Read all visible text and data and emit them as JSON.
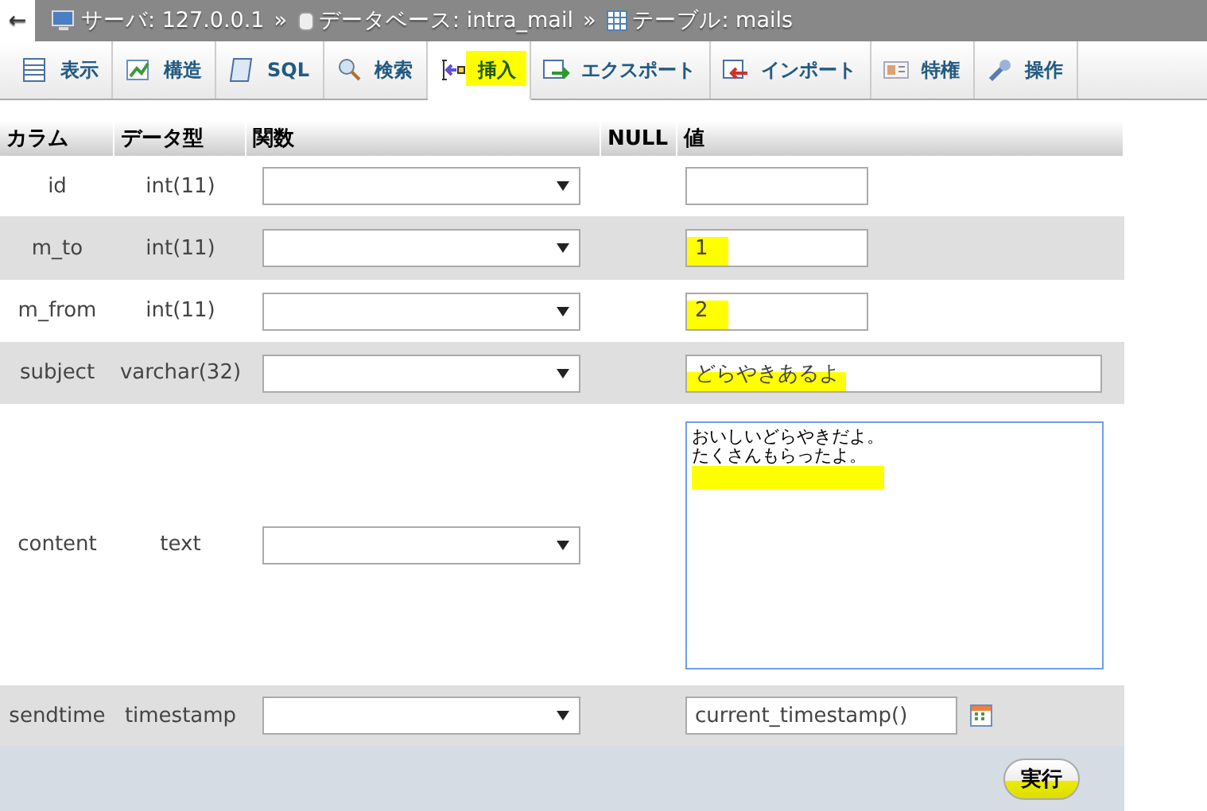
{
  "back": "←",
  "breadcrumb": [
    {
      "kind": "server",
      "label": "サーバ: 127.0.0.1",
      "separator": "»"
    },
    {
      "kind": "database",
      "label": "データベース: intra_mail",
      "separator": "»"
    },
    {
      "kind": "table",
      "label": "テーブル: mails"
    }
  ],
  "tabs": [
    {
      "kind": "browse",
      "label": "表示",
      "selected": false,
      "highlighted": false
    },
    {
      "kind": "structure",
      "label": "構造",
      "selected": false,
      "highlighted": false
    },
    {
      "kind": "sql",
      "label": "SQL",
      "selected": false,
      "highlighted": false
    },
    {
      "kind": "search",
      "label": "検索",
      "selected": false,
      "highlighted": false
    },
    {
      "kind": "insert",
      "label": "挿入",
      "selected": true,
      "highlighted": true
    },
    {
      "kind": "export",
      "label": "エクスポート",
      "selected": false,
      "highlighted": false
    },
    {
      "kind": "import",
      "label": "インポート",
      "selected": false,
      "highlighted": false
    },
    {
      "kind": "privileges",
      "label": "特権",
      "selected": false,
      "highlighted": false
    },
    {
      "kind": "operations",
      "label": "操作",
      "selected": false,
      "highlighted": false
    }
  ],
  "table": {
    "columns": [
      "カラム",
      "データ型",
      "関数",
      "NULL",
      "値"
    ],
    "rows": [
      {
        "name": "id",
        "type": "int(11)",
        "kind": "short",
        "highlighted": false
      },
      {
        "name": "m_to",
        "type": "int(11)",
        "kind": "short",
        "value": "1",
        "highlighted": true
      },
      {
        "name": "m_from",
        "type": "int(11)",
        "kind": "short",
        "value": "2",
        "highlighted": true
      },
      {
        "name": "subject",
        "type": "varchar(32)",
        "kind": "long",
        "value": "どらやきあるよ",
        "highlighted": true
      },
      {
        "name": "content",
        "type": "text",
        "kind": "textarea",
        "lines": [
          "おいしいどらやきだよ。",
          "たくさんもらったよ。"
        ],
        "highlighted": true
      },
      {
        "name": "sendtime",
        "type": "timestamp",
        "kind": "datetime",
        "value": "current_timestamp()",
        "highlighted": false
      }
    ]
  },
  "footer": {
    "button": "実行",
    "highlighted": true
  }
}
